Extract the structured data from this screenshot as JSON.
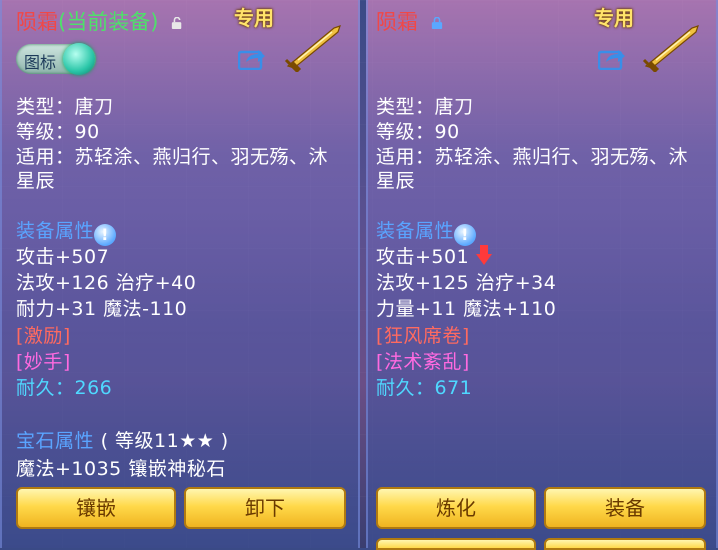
{
  "left_panel": {
    "title": "陨霜",
    "title_suffix": "(当前装备)",
    "exclusive_tag": "专用",
    "toggle_label": "图标",
    "type_line": "类型：唐刀",
    "level_line": "等级：90",
    "applies_line1": "适用：苏轻涂、燕归行、羽无殇、沐",
    "applies_line2": "星辰",
    "attr_header": "装备属性",
    "stat_attack": "攻击+507",
    "stat_line2": "法攻+126 治疗+40",
    "stat_line3": "耐力+31 魔法-110",
    "special1": "[激励]",
    "special2": "[妙手]",
    "durability": "耐久：266",
    "gem_header": "宝石属性",
    "gem_level": "( 等级11★★ )",
    "gem_stat": "魔法+1035 镶嵌神秘石",
    "btn_inlay": "镶嵌",
    "btn_unequip": "卸下"
  },
  "right_panel": {
    "title": "陨霜",
    "exclusive_tag": "专用",
    "type_line": "类型：唐刀",
    "level_line": "等级：90",
    "applies_line1": "适用：苏轻涂、燕归行、羽无殇、沐",
    "applies_line2": "星辰",
    "attr_header": "装备属性",
    "stat_attack": "攻击+501",
    "stat_line2": "法攻+125 治疗+34",
    "stat_line3": "力量+11 魔法+110",
    "special1": "[狂风席卷]",
    "special2": "[法术紊乱]",
    "durability": "耐久：671",
    "btn_refine": "炼化",
    "btn_equip": "装备"
  },
  "colors": {
    "title": "#f04848",
    "current_equipped": "#4ee06a",
    "section_header": "#5aa4ff",
    "durability": "#4fd8ff",
    "button_gold": "#ffd94a"
  }
}
